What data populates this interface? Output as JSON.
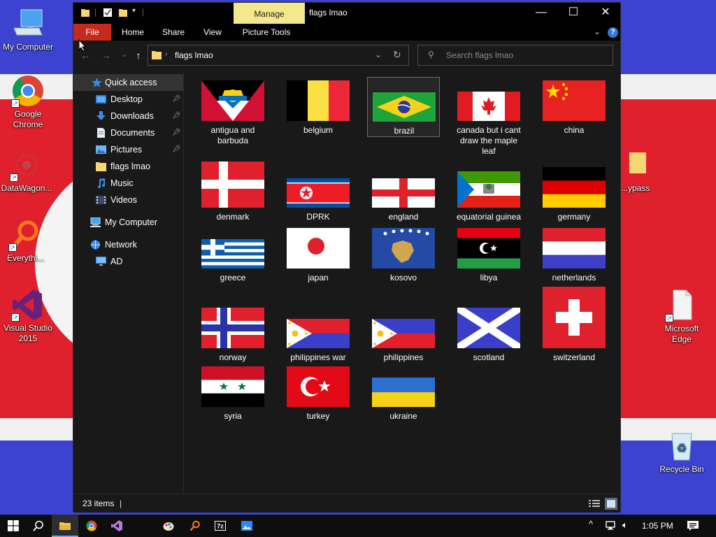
{
  "desktop": {
    "icons": [
      {
        "label": "My Computer"
      },
      {
        "label": "Google Chrome"
      },
      {
        "label": "DataWagon..."
      },
      {
        "label": "Everythi..."
      },
      {
        "label": "Visual Studio 2015"
      },
      {
        "label": "...ypass"
      },
      {
        "label": "Microsoft Edge"
      },
      {
        "label": "Recycle Bin"
      }
    ]
  },
  "window": {
    "title": "flags lmao",
    "manage_tab": "Manage",
    "controls": {
      "minimize": "—",
      "maximize": "☐",
      "close": "✕"
    },
    "ribbon_tabs": [
      "File",
      "Home",
      "Share",
      "View",
      "Picture Tools"
    ],
    "help": "?"
  },
  "address": {
    "path": "flags lmao",
    "search_placeholder": "Search flags lmao"
  },
  "nav": {
    "items": [
      {
        "label": "Quick access",
        "icon": "star-icon"
      },
      {
        "label": "Desktop",
        "icon": "desktop-folder-icon",
        "pinned": true
      },
      {
        "label": "Downloads",
        "icon": "downloads-icon",
        "pinned": true
      },
      {
        "label": "Documents",
        "icon": "documents-icon",
        "pinned": true
      },
      {
        "label": "Pictures",
        "icon": "pictures-icon",
        "pinned": true
      },
      {
        "label": "flags lmao",
        "icon": "folder-icon"
      },
      {
        "label": "Music",
        "icon": "music-icon"
      },
      {
        "label": "Videos",
        "icon": "videos-icon"
      },
      {
        "label": "My Computer",
        "icon": "computer-icon"
      },
      {
        "label": "Network",
        "icon": "network-icon"
      },
      {
        "label": "AD",
        "icon": "monitor-icon"
      }
    ]
  },
  "files": [
    {
      "label": "antigua and barbuda",
      "flag": "antigua"
    },
    {
      "label": "belgium",
      "flag": "belgium"
    },
    {
      "label": "brazil",
      "flag": "brazil",
      "selected": true
    },
    {
      "label": "canada but i cant draw the maple leaf",
      "flag": "canada"
    },
    {
      "label": "china",
      "flag": "china"
    },
    {
      "label": "denmark",
      "flag": "denmark"
    },
    {
      "label": "DPRK",
      "flag": "dprk"
    },
    {
      "label": "england",
      "flag": "england"
    },
    {
      "label": "equatorial guinea",
      "flag": "eqguinea"
    },
    {
      "label": "germany",
      "flag": "germany"
    },
    {
      "label": "greece",
      "flag": "greece"
    },
    {
      "label": "japan",
      "flag": "japan"
    },
    {
      "label": "kosovo",
      "flag": "kosovo"
    },
    {
      "label": "libya",
      "flag": "libya"
    },
    {
      "label": "netherlands",
      "flag": "netherlands"
    },
    {
      "label": "norway",
      "flag": "norway"
    },
    {
      "label": "philippines war",
      "flag": "philwar"
    },
    {
      "label": "philippines",
      "flag": "philippines"
    },
    {
      "label": "scotland",
      "flag": "scotland"
    },
    {
      "label": "switzerland",
      "flag": "switzerland"
    },
    {
      "label": "syria",
      "flag": "syria"
    },
    {
      "label": "turkey",
      "flag": "turkey"
    },
    {
      "label": "ukraine",
      "flag": "ukraine"
    }
  ],
  "status": {
    "count": "23 items"
  },
  "taskbar": {
    "apps": [
      "windows-start-icon",
      "search-icon",
      "file-explorer-icon",
      "chrome-icon",
      "visual-studio-icon",
      "paint-icon",
      "everything-icon",
      "7zip-icon",
      "app-icon"
    ],
    "clock": "1:05 PM"
  },
  "colors": {
    "accent_file_tab": "#c42b1c",
    "manage_tab": "#f3e88b",
    "window_bg": "#191919",
    "wallpaper_red": "#e0202c",
    "wallpaper_blue": "#3b43d0"
  }
}
